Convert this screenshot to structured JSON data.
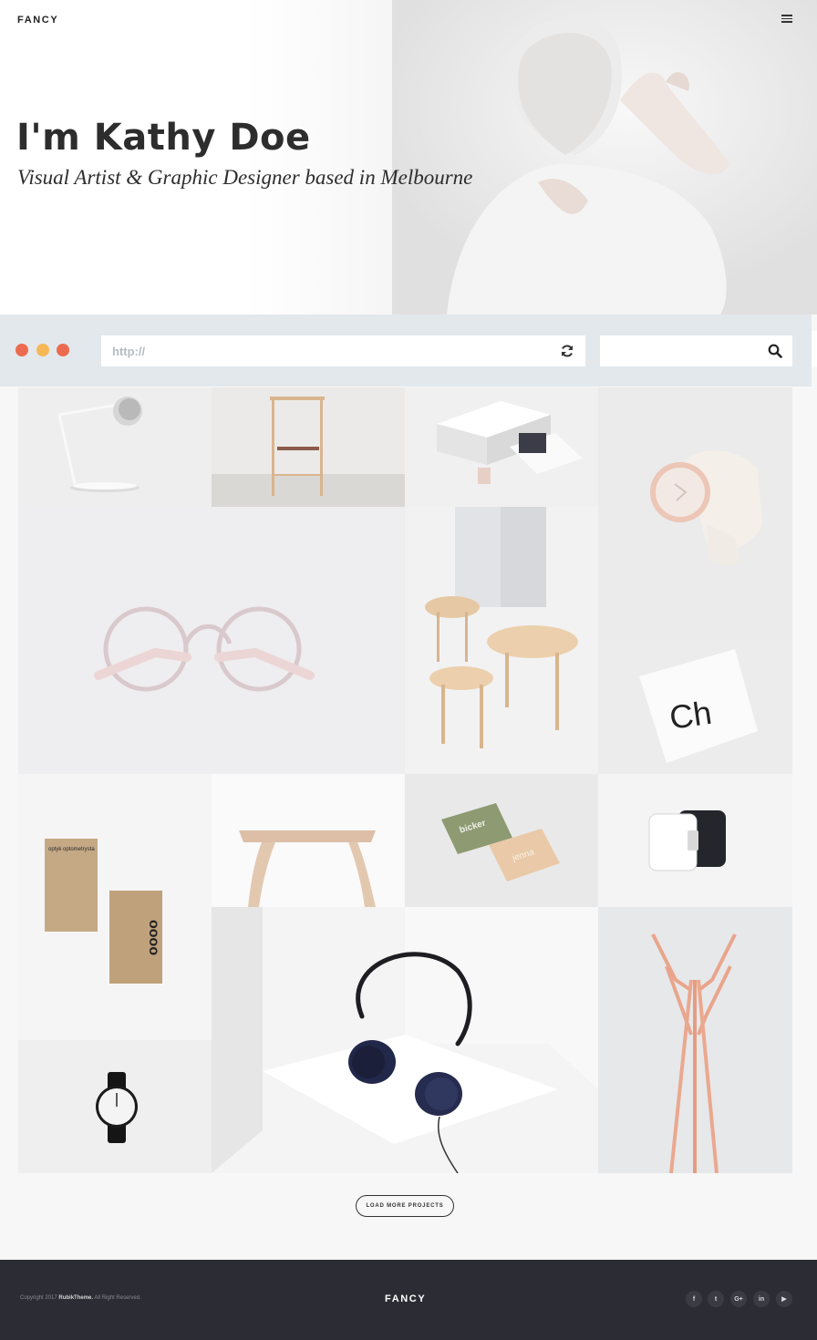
{
  "header": {
    "logo": "FANCY",
    "menu_icon": "hamburger-menu-icon"
  },
  "hero": {
    "title": "I'm Kathy Doe",
    "subtitle": "Visual Artist & Graphic Designer based in Melbourne"
  },
  "browser": {
    "dots": [
      "#ec6a4f",
      "#f5b855",
      "#ec6a4f"
    ],
    "url_placeholder": "http://",
    "refresh_icon": "refresh-icon",
    "search_icon": "search-icon"
  },
  "portfolio": {
    "items": [
      {
        "name": "desk-lamp"
      },
      {
        "name": "wooden-chair"
      },
      {
        "name": "packaging-set"
      },
      {
        "name": "pink-watch"
      },
      {
        "name": "round-glasses"
      },
      {
        "name": "wooden-tables"
      },
      {
        "name": "typography-poster",
        "text": "Ch"
      },
      {
        "name": "business-cards-kraft",
        "text_1": "optyk optometrysta",
        "text_2": "oooo"
      },
      {
        "name": "wooden-stool"
      },
      {
        "name": "color-business-cards",
        "text_1": "bicker",
        "text_2": "jenna"
      },
      {
        "name": "device-speakers"
      },
      {
        "name": "black-watch"
      },
      {
        "name": "headphones"
      },
      {
        "name": "coat-rack"
      }
    ],
    "load_more_label": "LOAD MORE PROJECTS"
  },
  "footer": {
    "copyright_prefix": "Copyright 2017",
    "copyright_brand": "RubikTheme.",
    "copyright_suffix": "All Right Reserved.",
    "logo": "FANCY",
    "social": [
      {
        "icon": "facebook-icon",
        "glyph": "f"
      },
      {
        "icon": "twitter-icon",
        "glyph": "t"
      },
      {
        "icon": "google-plus-icon",
        "glyph": "G+"
      },
      {
        "icon": "linkedin-icon",
        "glyph": "in"
      },
      {
        "icon": "youtube-icon",
        "glyph": "▶"
      }
    ]
  }
}
